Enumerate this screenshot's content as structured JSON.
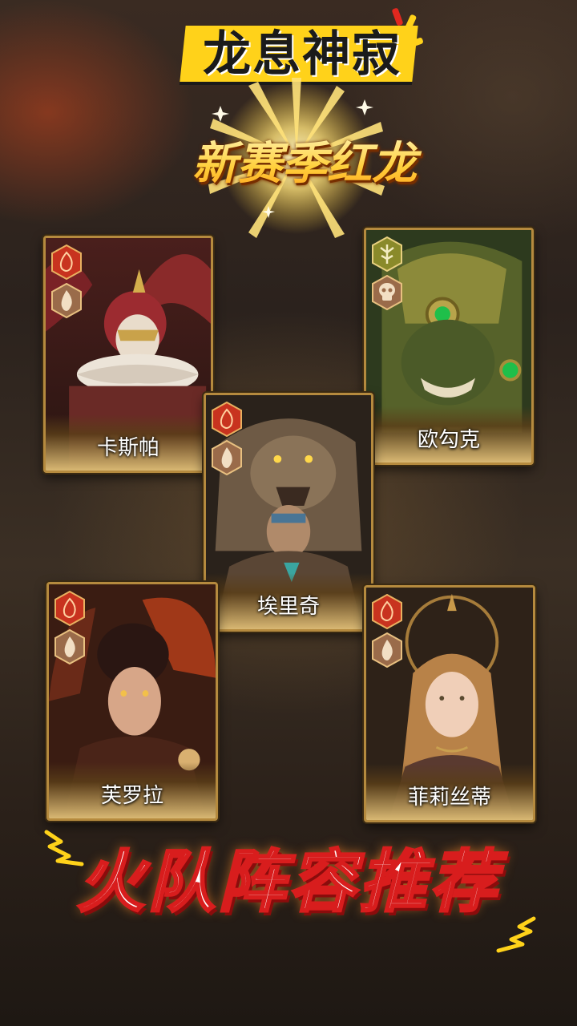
{
  "header": {
    "title": "龙息神寂",
    "subtitle": "新赛季红龙"
  },
  "cards": [
    {
      "name": "卡斯帕",
      "badges": [
        "fire-element-icon",
        "flame-class-icon"
      ]
    },
    {
      "name": "欧勾克",
      "badges": [
        "nature-element-icon",
        "skull-class-icon"
      ]
    },
    {
      "name": "埃里奇",
      "badges": [
        "fire-element-icon",
        "flame-class-icon"
      ]
    },
    {
      "name": "芙罗拉",
      "badges": [
        "fire-element-icon",
        "flame-class-icon"
      ]
    },
    {
      "name": "菲莉丝蒂",
      "badges": [
        "fire-element-icon",
        "flame-class-icon"
      ]
    }
  ],
  "footer": {
    "headline": "火队阵容推荐"
  },
  "colors": {
    "title_banner": "#ffd21a",
    "card_border": "#b58a3e",
    "fire_badge": "#c8331f",
    "flame_badge": "#9a6b4a",
    "nature_badge": "#8a8a2a",
    "headline_stroke": "#d81d1d"
  }
}
